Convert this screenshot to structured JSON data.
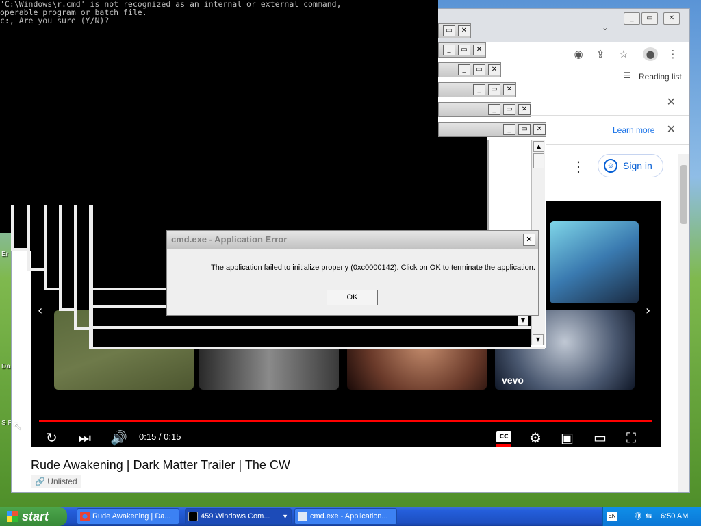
{
  "console": {
    "lines": [
      "'C:\\Windows\\r.cmd' is not recognized as an internal or external command,",
      "operable program or batch file.",
      "c:, Are you sure (Y/N)?"
    ]
  },
  "chrome": {
    "bookmarks": {
      "reading_list": "Reading list"
    },
    "infobar": {
      "learn_more": "Learn more"
    },
    "signin": "Sign in"
  },
  "video": {
    "time": "0:15 / 0:15",
    "cc": "CC",
    "title": "Rude Awakening | Dark Matter Trailer | The CW",
    "visibility": "Unlisted",
    "end_screen_logo": "vevo"
  },
  "dialog": {
    "title": "cmd.exe - Application Error",
    "message": "The application failed to initialize properly (0xc0000142). Click on OK to terminate the application.",
    "ok": "OK"
  },
  "taskbar": {
    "start": "start",
    "items": [
      {
        "label": "Rude Awakening | Da..."
      },
      {
        "label": "459 Windows Com..."
      },
      {
        "label": "cmd.exe - Application..."
      }
    ],
    "clock": "6:50 AM",
    "lang": "EN"
  },
  "desktop": {
    "icon_labels": [
      "Er",
      "Da",
      "S R"
    ]
  }
}
